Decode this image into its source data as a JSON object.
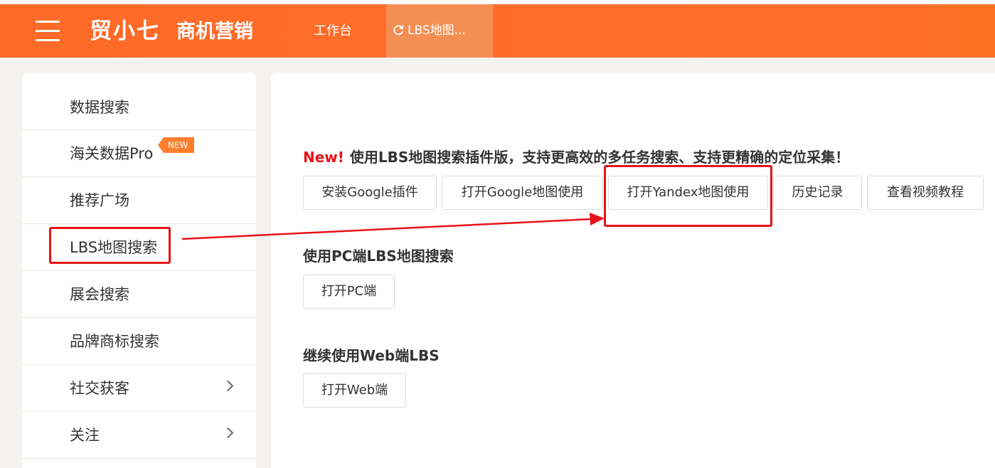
{
  "header": {
    "logo": "贸小七",
    "subtitle": "商机营销",
    "nav": {
      "workbench": "工作台",
      "active_tab": "LBS地图..."
    }
  },
  "sidebar": {
    "items": [
      {
        "label": "数据搜索"
      },
      {
        "label": "海关数据Pro",
        "badge": "NEW"
      },
      {
        "label": "推荐广场"
      },
      {
        "label": "LBS地图搜索"
      },
      {
        "label": "展会搜索"
      },
      {
        "label": "品牌商标搜索"
      },
      {
        "label": "社交获客"
      },
      {
        "label": "关注"
      }
    ]
  },
  "main": {
    "plugin_section": {
      "new_tag": "New!",
      "heading": "使用LBS地图搜索插件版，支持更高效的多任务搜索、支持更精确的定位采集！",
      "buttons": [
        "安装Google插件",
        "打开Google地图使用",
        "打开Yandex地图使用",
        "历史记录",
        "查看视频教程"
      ]
    },
    "pc_section": {
      "heading": "使用PC端LBS地图搜索",
      "button": "打开PC端"
    },
    "web_section": {
      "heading": "继续使用Web端LBS",
      "button": "打开Web端"
    }
  },
  "colors": {
    "brand_orange": "#fe6a28",
    "active_tab": "#f48f54",
    "highlight_red": "#e8121a",
    "badge_orange": "#ff7f2c"
  },
  "icons": {
    "menu": "hamburger-menu-icon",
    "refresh": "refresh-icon",
    "chevron": "chevron-right-icon"
  }
}
